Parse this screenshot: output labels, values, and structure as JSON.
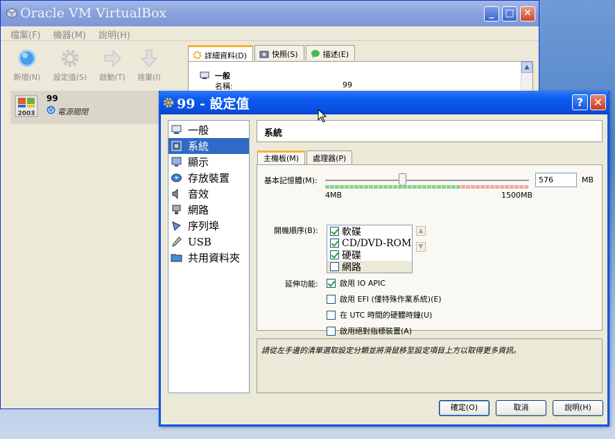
{
  "main_window": {
    "title": "Oracle VM VirtualBox",
    "menu": [
      "檔案(F)",
      "機器(M)",
      "說明(H)"
    ],
    "toolbar": {
      "new_label": "新增(N)",
      "settings_label": "設定值(S)",
      "start_label": "啟動(T)",
      "discard_label": "捨棄(I)"
    },
    "vm_list": [
      {
        "name": "99",
        "state": "電源關閉",
        "os_badge": "2003"
      }
    ],
    "detail_tabs": [
      "詳細資料(D)",
      "快照(S)",
      "描述(E)"
    ],
    "details": {
      "section_title": "一般",
      "rows": [
        {
          "key": "名稱:",
          "value": "99"
        }
      ]
    },
    "colors": {
      "title_bar": "#8aa3dc",
      "frame": "#ece9d8"
    }
  },
  "settings_dialog": {
    "title": "99 - 設定值",
    "categories": [
      "一般",
      "系統",
      "顯示",
      "存放裝置",
      "音效",
      "網路",
      "序列埠",
      "USB",
      "共用資料夾"
    ],
    "selected_category": "系統",
    "page_title": "系統",
    "tabs": [
      "主機板(M)",
      "處理器(P)"
    ],
    "active_tab": "主機板(M)",
    "memory": {
      "label": "基本記憶體(M):",
      "value": "576",
      "unit": "MB",
      "min_label": "4MB",
      "max_label": "1500MB",
      "slider_fraction": 0.38
    },
    "boot_order": {
      "label": "開機順序(B):",
      "items": [
        {
          "label": "軟碟",
          "checked": true
        },
        {
          "label": "CD/DVD-ROM",
          "checked": true
        },
        {
          "label": "硬碟",
          "checked": true
        },
        {
          "label": "網路",
          "checked": false
        }
      ]
    },
    "extended_features": {
      "label": "延伸功能:",
      "options": [
        {
          "label": "啟用 IO APIC",
          "checked": true
        },
        {
          "label": "啟用 EFI (僅特殊作業系統)(E)",
          "checked": false
        },
        {
          "label": "在 UTC 時間的硬體時鐘(U)",
          "checked": false
        },
        {
          "label": "啟用絕對指標裝置(A)",
          "checked": false
        }
      ]
    },
    "hint": "請從左手邊的清單選取設定分類並將滑鼠移至設定項目上方以取得更多資訊。",
    "buttons": {
      "ok": "確定(O)",
      "cancel": "取消",
      "help": "說明(H)"
    },
    "colors": {
      "title_bar": "#0a5bf0",
      "selection": "#316ac5",
      "tab_accent": "#f5b33a"
    }
  }
}
